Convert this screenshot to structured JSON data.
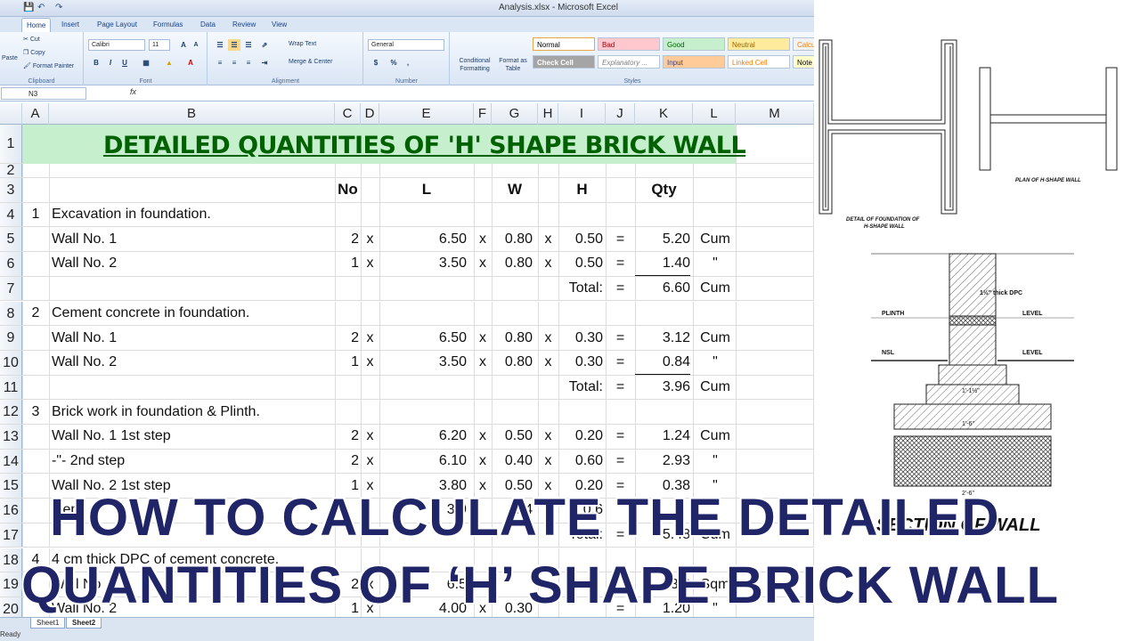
{
  "window": {
    "title": "Analysis.xlsx - Microsoft Excel"
  },
  "ribbon": {
    "tabs": [
      "Home",
      "Insert",
      "Page Layout",
      "Formulas",
      "Data",
      "Review",
      "View"
    ],
    "clipboard": {
      "paste": "Paste",
      "cut": "Cut",
      "copy": "Copy",
      "format_painter": "Format Painter",
      "label": "Clipboard"
    },
    "font": {
      "name": "Calibri",
      "size": "11",
      "label": "Font",
      "bold": "B",
      "italic": "I",
      "underline": "U"
    },
    "alignment": {
      "wrap": "Wrap Text",
      "merge": "Merge & Center",
      "label": "Alignment"
    },
    "number": {
      "format": "General",
      "currency": "$",
      "percent": "%",
      "comma": ",",
      "label": "Number"
    },
    "styles": {
      "conditional": "Conditional Formatting",
      "format_table": "Format as Table",
      "cells": [
        "Normal",
        "Bad",
        "Good",
        "Neutral",
        "Calcu",
        "Check Cell",
        "Explanatory ...",
        "Input",
        "Linked Cell",
        "Note"
      ],
      "label": "Styles"
    }
  },
  "formula_bar": {
    "name_box": "N3",
    "fx": "fx",
    "value": ""
  },
  "columns": [
    "A",
    "B",
    "C",
    "D",
    "E",
    "F",
    "G",
    "H",
    "I",
    "J",
    "K",
    "L",
    "M"
  ],
  "sheet": {
    "title": "DETAILED QUANTITIES OF 'H' SHAPE BRICK WALL",
    "headers": {
      "no": "No",
      "l": "L",
      "w": "W",
      "h": "H",
      "qty": "Qty"
    },
    "rows": [
      {
        "n": "1",
        "title": true
      },
      {
        "n": "2"
      },
      {
        "n": "3",
        "header": true
      },
      {
        "n": "4",
        "a": "1",
        "b": "Excavation in foundation."
      },
      {
        "n": "5",
        "b": "Wall No. 1",
        "c": "2",
        "d": "x",
        "e": "6.50",
        "f": "x",
        "g": "0.80",
        "h": "x",
        "i": "0.50",
        "j": "=",
        "k": "5.20",
        "l": "Cum"
      },
      {
        "n": "6",
        "b": "Wall No. 2",
        "c": "1",
        "d": "x",
        "e": "3.50",
        "f": "x",
        "g": "0.80",
        "h": "x",
        "i": "0.50",
        "j": "=",
        "k": "1.40",
        "l": "\"",
        "underline_k": true
      },
      {
        "n": "7",
        "i": "Total:",
        "j": "=",
        "k": "6.60",
        "l": "Cum"
      },
      {
        "n": "8",
        "a": "2",
        "b": "Cement concrete in foundation."
      },
      {
        "n": "9",
        "b": "Wall No. 1",
        "c": "2",
        "d": "x",
        "e": "6.50",
        "f": "x",
        "g": "0.80",
        "h": "x",
        "i": "0.30",
        "j": "=",
        "k": "3.12",
        "l": "Cum"
      },
      {
        "n": "10",
        "b": "Wall No. 2",
        "c": "1",
        "d": "x",
        "e": "3.50",
        "f": "x",
        "g": "0.80",
        "h": "x",
        "i": "0.30",
        "j": "=",
        "k": "0.84",
        "l": "\"",
        "underline_k": true
      },
      {
        "n": "11",
        "i": "Total:",
        "j": "=",
        "k": "3.96",
        "l": "Cum"
      },
      {
        "n": "12",
        "a": "3",
        "b": "Brick work in foundation & Plinth."
      },
      {
        "n": "13",
        "b": "Wall No. 1 1st step",
        "c": "2",
        "d": "x",
        "e": "6.20",
        "f": "x",
        "g": "0.50",
        "h": "x",
        "i": "0.20",
        "j": "=",
        "k": "1.24",
        "l": "Cum"
      },
      {
        "n": "14",
        "b": "-\"-              2nd step",
        "c": "2",
        "d": "x",
        "e": "6.10",
        "f": "x",
        "g": "0.40",
        "h": "x",
        "i": "0.60",
        "j": "=",
        "k": "2.93",
        "l": "\""
      },
      {
        "n": "15",
        "b": "Wall No. 2 1st step",
        "c": "1",
        "d": "x",
        "e": "3.80",
        "f": "x",
        "g": "0.50",
        "h": "x",
        "i": "0.20",
        "j": "=",
        "k": "0.38",
        "l": "\""
      },
      {
        "n": "16",
        "b": "                   step",
        "c": "",
        "e": "3.9",
        "g": "0.4",
        "i": "0.6",
        "j": "",
        "k": "",
        "l": ""
      },
      {
        "n": "17",
        "i": "Total:",
        "j": "=",
        "k": "5.48",
        "l": "Cum"
      },
      {
        "n": "18",
        "a": "4",
        "b": "4 cm thick DPC of cement concrete."
      },
      {
        "n": "19",
        "b": "Wall No",
        "c": "2",
        "d": "x",
        "e": "6.5",
        "f": "x",
        "k": "3.6",
        "l": "Sqm"
      },
      {
        "n": "20",
        "b": "Wall No. 2",
        "c": "1",
        "d": "x",
        "e": "4.00",
        "f": "x",
        "g": "0.30",
        "j": "=",
        "k": "1.20",
        "l": "\""
      }
    ]
  },
  "sheet_tabs": [
    "Sheet1",
    "Sheet2"
  ],
  "status": "Ready",
  "drawings": {
    "plan_caption": "PLAN OF H-SHAPE WALL",
    "foundation_caption_1": "DETAIL OF FOUNDATION  OF",
    "foundation_caption_2": "H-SHAPE WALL",
    "dpc": "1½\" thick DPC",
    "plinth": "PLINTH",
    "level": "LEVEL",
    "nsl": "NSL",
    "dim_1": "1'-1½\"",
    "dim_2": "1'-6\"",
    "dim_3": "2'-6\"",
    "section_caption": "SECTION OF WALL"
  },
  "overlay": {
    "line1": "HOW TO CALCULATE THE DETAILED",
    "line2": "QUANTITIES OF ‘H’ SHAPE BRICK WALL"
  }
}
